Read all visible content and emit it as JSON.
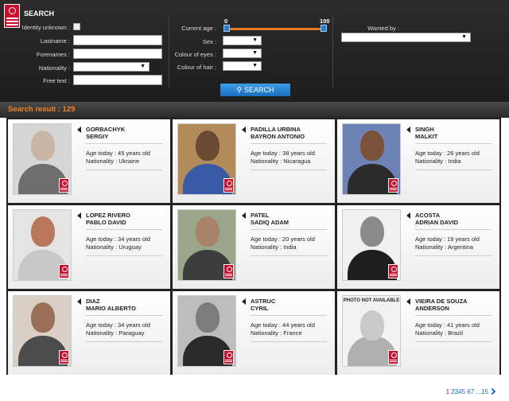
{
  "search": {
    "title": "SEARCH",
    "identity_unknown_label": "Identity unknown :",
    "lastname_label": "Lastname :",
    "forenames_label": "Forenames :",
    "nationality_label": "Nationality :",
    "free_text_label": "Free text :",
    "current_age_label": "Current age :",
    "sex_label": "Sex :",
    "colour_eyes_label": "Colour of eyes :",
    "colour_hair_label": "Colour of hair :",
    "wanted_by_label": "Wanted by :",
    "age_min": "0",
    "age_max": "100",
    "button_label": "SEARCH"
  },
  "results": {
    "title": "Search result : 129"
  },
  "cards": [
    {
      "surname": "GORBACHYK",
      "forename": "SERGIY",
      "age": "Age today : 45 years old",
      "nationality": "Nationality : Ukraine",
      "photo": "photo",
      "skin": "#c8b5a3",
      "shirt": "#6e6e6e",
      "bg": "#d6d6d6"
    },
    {
      "surname": "PADILLA URBINA",
      "forename": "BAYRON ANTONIO",
      "age": "Age today : 38 years old",
      "nationality": "Nationality : Nicaragua",
      "photo": "photo",
      "skin": "#6b4a33",
      "shirt": "#3a5aa8",
      "bg": "#b38a5a"
    },
    {
      "surname": "SINGH",
      "forename": "MALKIT",
      "age": "Age today : 26 years old",
      "nationality": "Nationality : India",
      "photo": "photo",
      "skin": "#7a5238",
      "shirt": "#2b2b2b",
      "bg": "#6d83b8"
    },
    {
      "surname": "LOPEZ RIVERO",
      "forename": "PABLO DAVID",
      "age": "Age today : 34 years old",
      "nationality": "Nationality : Uruguay",
      "photo": "photo",
      "skin": "#b8765a",
      "shirt": "#c8c8c8",
      "bg": "#e4e4e4"
    },
    {
      "surname": "PATEL",
      "forename": "SADIQ ADAM",
      "age": "Age today : 20 years old",
      "nationality": "Nationality : India",
      "photo": "photo",
      "skin": "#a8836a",
      "shirt": "#3d3d3d",
      "bg": "#9aa58a"
    },
    {
      "surname": "ACOSTA",
      "forename": "ADRIAN DAVID",
      "age": "Age today : 19 years old",
      "nationality": "Nationality : Argentina",
      "photo": "photo",
      "skin": "#8a8a8a",
      "shirt": "#1e1e1e",
      "bg": "#f0f0f0"
    },
    {
      "surname": "DIAZ",
      "forename": "MARIO ALBERTO",
      "age": "Age today : 34 years old",
      "nationality": "Nationality : Paraguay",
      "photo": "photo",
      "skin": "#9a6f57",
      "shirt": "#4b4b4b",
      "bg": "#d9cfc5"
    },
    {
      "surname": "ASTRUC",
      "forename": "CYRIL",
      "age": "Age today : 44 years old",
      "nationality": "Nationality : France",
      "photo": "photo",
      "skin": "#7d7d7d",
      "shirt": "#2a2a2a",
      "bg": "#bdbdbd"
    },
    {
      "surname": "VIEIRA DE SOUZA",
      "forename": "ANDERSON",
      "age": "Age today : 41 years old",
      "nationality": "Nationality : Brazil",
      "photo": "na",
      "photo_label": "PHOTO NOT AVAILABLE",
      "skin": "#c9c9c9",
      "shirt": "#b0b0b0",
      "bg": "#f2f2f2"
    }
  ],
  "pagination": {
    "current": "1",
    "pages": "2345 67 ...15"
  },
  "colors": {
    "accent_orange": "#f58220",
    "brand_red": "#c8102e",
    "link_blue": "#1a6fbd"
  }
}
